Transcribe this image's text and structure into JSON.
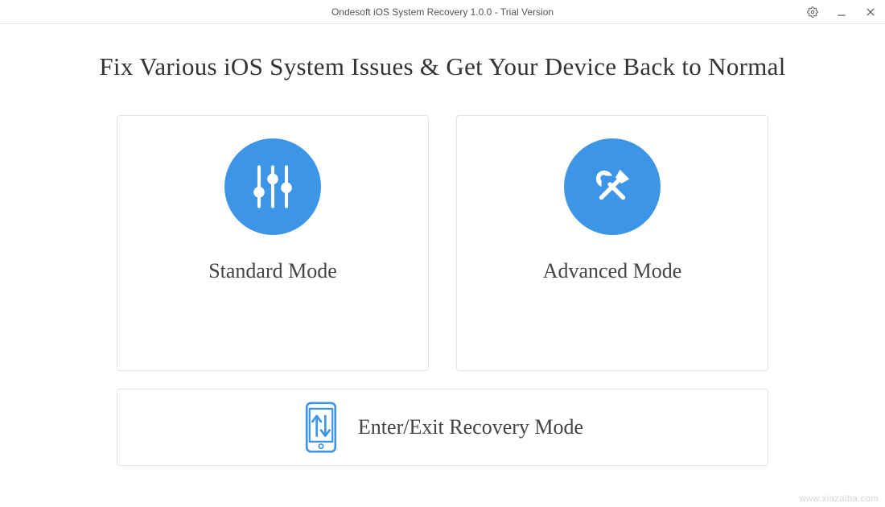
{
  "window": {
    "title": "Ondesoft iOS System Recovery 1.0.0 - Trial Version"
  },
  "headline": "Fix Various iOS System Issues & Get Your Device Back to Normal",
  "modes": {
    "standard": {
      "label": "Standard Mode"
    },
    "advanced": {
      "label": "Advanced Mode"
    }
  },
  "recovery": {
    "label": "Enter/Exit Recovery Mode"
  },
  "colors": {
    "accent": "#3d95e8",
    "border": "#e3e3e3",
    "text_primary": "#333333",
    "text_secondary": "#444444"
  },
  "watermark": "www.xiazaiba.com"
}
